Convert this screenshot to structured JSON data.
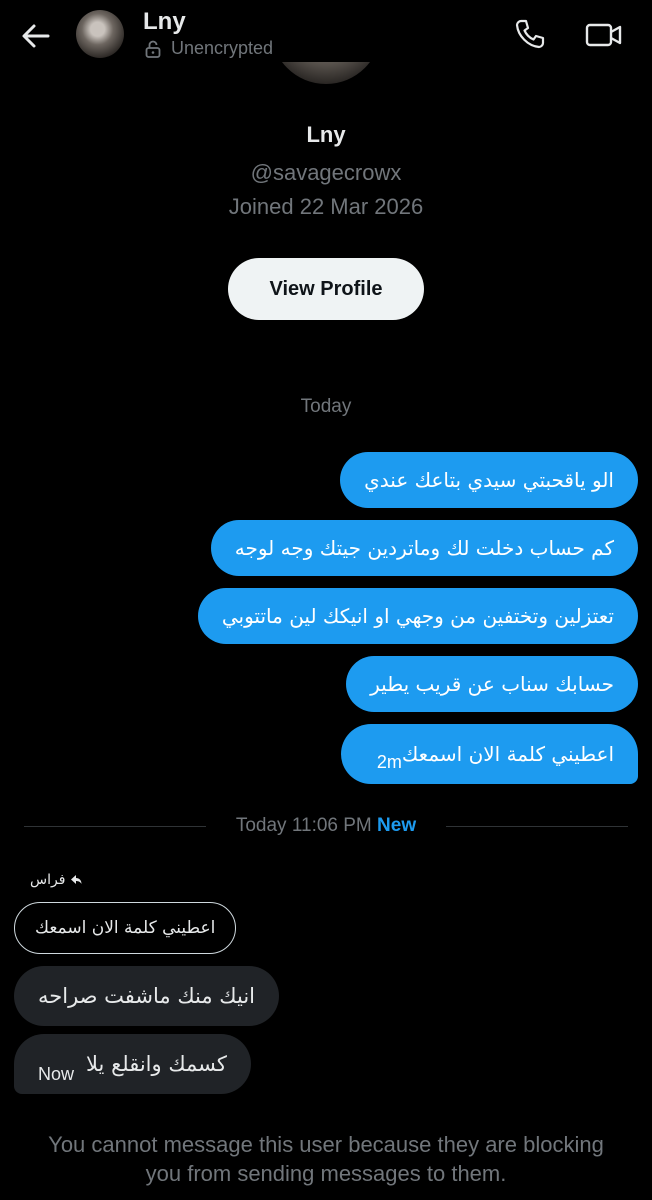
{
  "header": {
    "name": "Lny",
    "encryption_status": "Unencrypted",
    "icons": {
      "back": "arrow-left-icon",
      "lock": "lock-open-icon",
      "call": "phone-icon",
      "video": "video-camera-icon"
    }
  },
  "profile": {
    "name": "Lny",
    "handle": "@savagecrowx",
    "joined": "Joined 22 Mar 2026",
    "view_profile_label": "View Profile"
  },
  "conversation": {
    "day_label": "Today",
    "sent_messages": [
      {
        "text": "الو ياقحبتي سيدي بتاعك عندي"
      },
      {
        "text": "كم حساب دخلت لك وماتردين جيتك وجه لوجه"
      },
      {
        "text": "تعتزلين وتختفين من وجهي او انيكك لين ماتتوبي"
      },
      {
        "text": "حسابك سناب عن قريب يطير"
      },
      {
        "text": "اعطيني كلمة الان اسمعك",
        "time": "2m"
      }
    ],
    "new_separator": {
      "label": "Today 11:06 PM",
      "new_label": "New"
    },
    "reply_to": {
      "author": "فراس",
      "quoted_text": "اعطيني كلمة الان اسمعك"
    },
    "received_messages": [
      {
        "text": "انيك منك ماشفت صراحه"
      },
      {
        "text": "كسمك وانقلع يلا",
        "time": "Now"
      }
    ]
  },
  "footer": {
    "blocked_notice": "You cannot message this user because they are blocking you from sending messages to them."
  },
  "colors": {
    "accent": "#1d9bf0",
    "background": "#000000",
    "received_bubble": "#202327",
    "muted_text": "#71767b"
  }
}
